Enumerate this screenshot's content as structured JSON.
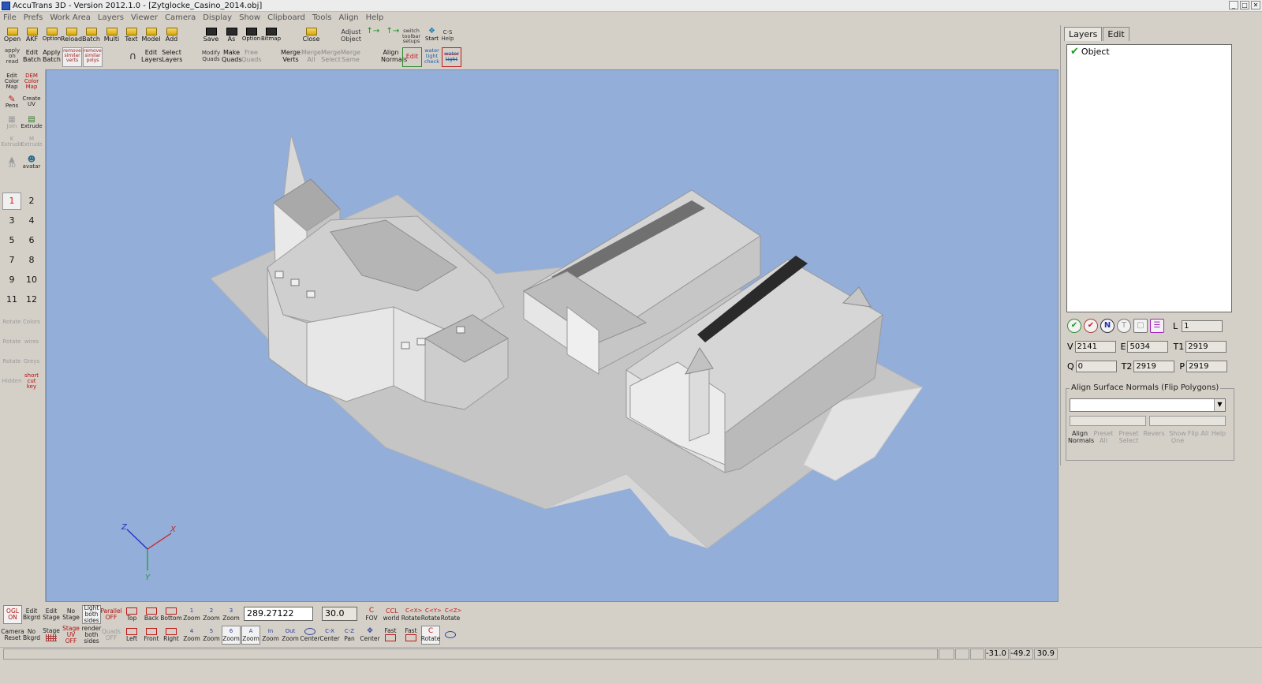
{
  "window": {
    "title": "AccuTrans 3D - Version 2012.1.0 - [Zytglocke_Casino_2014.obj]",
    "controls": [
      "_",
      "□",
      "✕"
    ]
  },
  "menu": [
    "File",
    "Prefs",
    "Work Area",
    "Layers",
    "Viewer",
    "Camera",
    "Display",
    "Show",
    "Clipboard",
    "Tools",
    "Align",
    "Help"
  ],
  "toolbar_top": {
    "row1": [
      {
        "label": "Open",
        "icon": "open-folder-icon"
      },
      {
        "label": "AKF",
        "icon": "akf-folder-icon"
      },
      {
        "label": "Option",
        "icon": "option-folder-icon"
      },
      {
        "label": "Reload",
        "icon": "reload-folder-icon"
      },
      {
        "label": "Batch",
        "icon": "batch-folder-icon"
      },
      {
        "label": "Multi",
        "icon": "multi-folder-icon"
      },
      {
        "label": "Text",
        "icon": "text-folder-icon"
      },
      {
        "label": "Model",
        "icon": "model-folder-icon"
      },
      {
        "label": "Add",
        "icon": "add-folder-icon"
      },
      {
        "label": "Save",
        "icon": "save-disk-icon"
      },
      {
        "label": "As",
        "icon": "save-as-disk-icon"
      },
      {
        "label": "Option",
        "icon": "save-option-disk-icon"
      },
      {
        "label": "Bitmap",
        "icon": "bitmap-disk-icon"
      },
      {
        "label": "Close",
        "icon": "close-folder-icon"
      },
      {
        "label": "Adjust Object",
        "icon": "adjust-object-icon"
      },
      {
        "label": "",
        "icon": "align-h-icon"
      },
      {
        "label": "",
        "icon": "align-v-icon"
      },
      {
        "label": "switch toolbar setups",
        "icon": "switch-toolbar-icon"
      },
      {
        "label": "Start",
        "icon": "start-icon"
      },
      {
        "label": "C-S Help",
        "icon": "cs-help-icon"
      }
    ],
    "row2": [
      {
        "label": "apply on read",
        "icon": "apply-on-read-icon"
      },
      {
        "label": "Edit Batch",
        "icon": "edit-batch-icon"
      },
      {
        "label": "Apply Batch",
        "icon": "apply-batch-icon"
      },
      {
        "label": "remove similar verts",
        "icon": "remove-similar-verts-icon"
      },
      {
        "label": "remove similar polys",
        "icon": "remove-similar-polys-icon"
      },
      {
        "label": "",
        "icon": "magnet-icon"
      },
      {
        "label": "Edit Layers",
        "icon": "edit-layers-icon"
      },
      {
        "label": "Select Layers",
        "icon": "select-layers-icon"
      },
      {
        "label": "Modify Quads",
        "icon": "modify-quads-icon"
      },
      {
        "label": "Make Quads",
        "icon": "make-quads-icon"
      },
      {
        "label": "Free Quads",
        "icon": "free-quads-icon"
      },
      {
        "label": "Merge Verts",
        "icon": "merge-verts-icon"
      },
      {
        "label": "Merge All",
        "icon": "merge-all-icon"
      },
      {
        "label": "Merge Select",
        "icon": "merge-select-icon"
      },
      {
        "label": "Merge Same",
        "icon": "merge-same-icon"
      },
      {
        "label": "Align Normals",
        "icon": "align-normals-icon"
      },
      {
        "label": "Edit",
        "icon": "edit-green-icon"
      },
      {
        "label": "water tight check",
        "icon": "water-tight-check-icon"
      },
      {
        "label": "water tight",
        "icon": "water-tight-icon"
      }
    ]
  },
  "left_palette": {
    "tools": [
      {
        "label": "Edit Color Map",
        "icon": "edit-color-map-icon"
      },
      {
        "label": "DEM Color Map",
        "icon": "dem-color-map-icon"
      },
      {
        "label": "Pens",
        "icon": "pens-icon"
      },
      {
        "label": "Create UV",
        "icon": "create-uv-icon"
      },
      {
        "label": "Join",
        "icon": "join-icon"
      },
      {
        "label": "Extrude",
        "icon": "extrude-icon"
      },
      {
        "label": "K Extrude",
        "icon": "k-extrude-icon"
      },
      {
        "label": "M Extrude",
        "icon": "m-extrude-icon"
      },
      {
        "label": "3D",
        "icon": "3d-icon"
      },
      {
        "label": "avatar",
        "icon": "avatar-icon"
      }
    ],
    "numbers": [
      "1",
      "2",
      "3",
      "4",
      "5",
      "6",
      "7",
      "8",
      "9",
      "10",
      "11",
      "12"
    ],
    "bottom_tools": [
      {
        "label": "Rotate",
        "icon": "color-rotate-icon"
      },
      {
        "label": "Colors",
        "icon": "colors-icon"
      },
      {
        "label": "Rotate",
        "icon": "verts-rotate-icon"
      },
      {
        "label": "wires",
        "icon": "wires-icon"
      },
      {
        "label": "Rotate",
        "icon": "lines-rotate-icon"
      },
      {
        "label": "Greys",
        "icon": "greys-icon"
      },
      {
        "label": "Hidden",
        "icon": "hidden-icon"
      },
      {
        "label": "short cut key",
        "icon": "shortcut-key-icon"
      }
    ]
  },
  "right_panel": {
    "tabs": [
      "Layers",
      "Edit"
    ],
    "layers": [
      {
        "name": "Object",
        "checked": true
      }
    ],
    "icon_buttons": [
      {
        "glyph": "✔",
        "icon": "check-all-icon"
      },
      {
        "glyph": "✔",
        "icon": "check-toggle-icon"
      },
      {
        "glyph": "N",
        "icon": "n-icon"
      },
      {
        "glyph": "T",
        "icon": "t-icon"
      },
      {
        "glyph": "▢",
        "icon": "box-icon"
      },
      {
        "glyph": "☰",
        "icon": "tree-icon"
      }
    ],
    "l_label": "L",
    "l_value": "1",
    "stats": {
      "v_label": "V",
      "v": "2141",
      "e_label": "E",
      "e": "5034",
      "t1_label": "T1",
      "t1": "2919",
      "q_label": "Q",
      "q": "0",
      "t2_label": "T2",
      "t2": "2919",
      "p_label": "P",
      "p": "2919"
    },
    "align_group_title": "Align Surface Normals (Flip Polygons)",
    "align_buttons": [
      "Align Normals",
      "Preset All",
      "Preset Select",
      "Revers",
      "Show One",
      "Flip All",
      "Help"
    ]
  },
  "bottom_toolbar": {
    "row1": [
      "OGL ON",
      "Edit Bkgrd",
      "Edit Stage",
      "No Stage",
      "Light both sides",
      "Parallel OFF",
      "Top",
      "Back",
      "Bottom",
      "Zoom",
      "Zoom",
      "Zoom",
      "FOV",
      "world",
      "Rotate",
      "Rotate",
      "Rotate"
    ],
    "row1_markers": [
      "1",
      "2",
      "3"
    ],
    "row2": [
      "Camera Reset",
      "No Bkgrd",
      "Stage",
      "Stage UV OFF",
      "render both sides",
      "Quads OFF",
      "Left",
      "Front",
      "Right",
      "Zoom",
      "Zoom",
      "Zoom",
      "Zoom",
      "Zoom",
      "Zoom",
      "Center",
      "Center",
      "Pan",
      "Center",
      "Fast",
      "Rotate"
    ],
    "row2_markers": [
      "4",
      "5",
      "6",
      "A",
      "In",
      "Out"
    ],
    "zoom_value": "289.27122",
    "fov_value": "30.0"
  },
  "status": {
    "x": "-31.0",
    "y": "-49.2",
    "z": "30.9"
  },
  "axis": {
    "x_label": "X",
    "y_label": "Y",
    "z_label": "Z"
  },
  "colors": {
    "viewport_bg": "#93aed8",
    "ui_bg": "#d4d0c8",
    "model_light": "#e8e8e8",
    "model_mid": "#bcbcbc",
    "model_dark": "#8c8c8c",
    "axis_x": "#d02020",
    "axis_y": "#20a030",
    "axis_z": "#2030c0"
  }
}
